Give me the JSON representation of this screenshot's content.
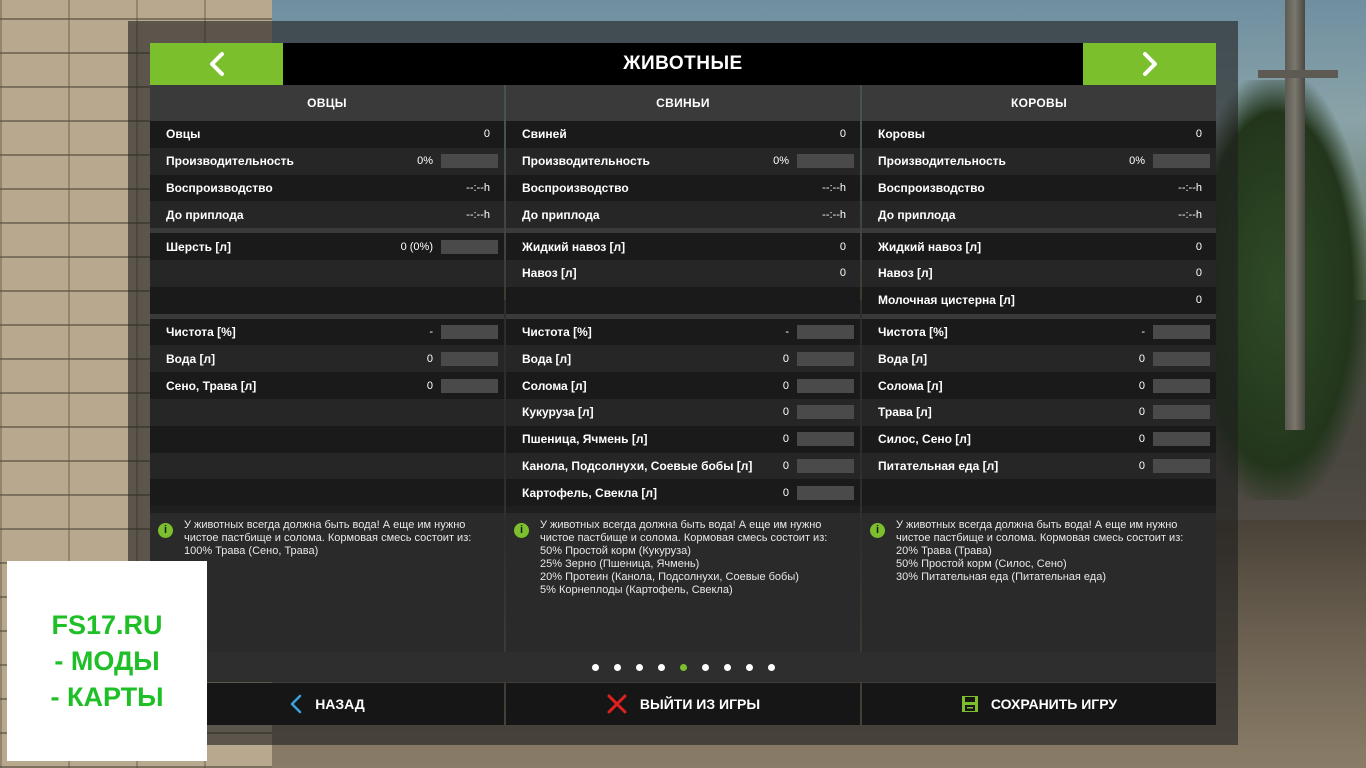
{
  "title": "ЖИВОТНЫЕ",
  "colors": {
    "accent": "#7cbf2d",
    "exit_red": "#e02020",
    "back_blue": "#3aa0e0",
    "save_green": "#7cbf2d",
    "watermark": "#1fbf27"
  },
  "icons": {
    "prev": "chevron-left-icon",
    "next": "chevron-right-icon",
    "info": "info-icon",
    "back": "chevron-left-icon",
    "exit": "close-icon",
    "save": "floppy-disk-icon"
  },
  "columns": [
    {
      "header": "ОВЦЫ",
      "group1": [
        {
          "label": "Овцы",
          "value": "0",
          "bar": false
        },
        {
          "label": "Производительность",
          "value": "0%",
          "bar": true
        },
        {
          "label": "Воспроизводство",
          "value": "--:--h",
          "bar": false
        },
        {
          "label": "До приплода",
          "value": "--:--h",
          "bar": false
        }
      ],
      "group2": [
        {
          "label": "Шерсть [л]",
          "value": "0 (0%)",
          "bar": true
        },
        {
          "label": "",
          "value": "",
          "bar": false
        },
        {
          "label": "",
          "value": "",
          "bar": false
        }
      ],
      "group3": [
        {
          "label": "Чистота [%]",
          "value": "-",
          "bar": true
        },
        {
          "label": "Вода [л]",
          "value": "0",
          "bar": true
        },
        {
          "label": "Сено, Трава [л]",
          "value": "0",
          "bar": true
        },
        {
          "label": "",
          "value": "",
          "bar": false
        },
        {
          "label": "",
          "value": "",
          "bar": false
        },
        {
          "label": "",
          "value": "",
          "bar": false
        },
        {
          "label": "",
          "value": "",
          "bar": false
        }
      ],
      "info": [
        "У животных всегда должна быть вода! А еще им нужно чистое пастбище и солома. Кормовая смесь состоит из:",
        "100% Трава (Сено, Трава)"
      ]
    },
    {
      "header": "СВИНЬИ",
      "group1": [
        {
          "label": "Свиней",
          "value": "0",
          "bar": false
        },
        {
          "label": "Производительность",
          "value": "0%",
          "bar": true
        },
        {
          "label": "Воспроизводство",
          "value": "--:--h",
          "bar": false
        },
        {
          "label": "До приплода",
          "value": "--:--h",
          "bar": false
        }
      ],
      "group2": [
        {
          "label": "Жидкий навоз [л]",
          "value": "0",
          "bar": false
        },
        {
          "label": "Навоз [л]",
          "value": "0",
          "bar": false
        },
        {
          "label": "",
          "value": "",
          "bar": false
        }
      ],
      "group3": [
        {
          "label": "Чистота [%]",
          "value": "-",
          "bar": true
        },
        {
          "label": "Вода [л]",
          "value": "0",
          "bar": true
        },
        {
          "label": "Солома [л]",
          "value": "0",
          "bar": true
        },
        {
          "label": "Кукуруза [л]",
          "value": "0",
          "bar": true
        },
        {
          "label": "Пшеница, Ячмень [л]",
          "value": "0",
          "bar": true
        },
        {
          "label": "Канола, Подсолнухи, Соевые бобы [л]",
          "value": "0",
          "bar": true
        },
        {
          "label": "Картофель, Свекла [л]",
          "value": "0",
          "bar": true
        }
      ],
      "info": [
        "У животных всегда должна быть вода! А еще им нужно чистое пастбище и солома. Кормовая смесь состоит из:",
        "50% Простой корм (Кукуруза)",
        "25% Зерно (Пшеница, Ячмень)",
        "20% Протеин (Канола, Подсолнухи, Соевые бобы)",
        "5% Корнеплоды (Картофель, Свекла)"
      ]
    },
    {
      "header": "КОРОВЫ",
      "group1": [
        {
          "label": "Коровы",
          "value": "0",
          "bar": false
        },
        {
          "label": "Производительность",
          "value": "0%",
          "bar": true
        },
        {
          "label": "Воспроизводство",
          "value": "--:--h",
          "bar": false
        },
        {
          "label": "До приплода",
          "value": "--:--h",
          "bar": false
        }
      ],
      "group2": [
        {
          "label": "Жидкий навоз [л]",
          "value": "0",
          "bar": false
        },
        {
          "label": "Навоз [л]",
          "value": "0",
          "bar": false
        },
        {
          "label": "Молочная цистерна [л]",
          "value": "0",
          "bar": false
        }
      ],
      "group3": [
        {
          "label": "Чистота [%]",
          "value": "-",
          "bar": true
        },
        {
          "label": "Вода [л]",
          "value": "0",
          "bar": true
        },
        {
          "label": "Солома [л]",
          "value": "0",
          "bar": true
        },
        {
          "label": "Трава [л]",
          "value": "0",
          "bar": true
        },
        {
          "label": "Силос, Сено [л]",
          "value": "0",
          "bar": true
        },
        {
          "label": "Питательная еда [л]",
          "value": "0",
          "bar": true
        },
        {
          "label": "",
          "value": "",
          "bar": false
        }
      ],
      "info": [
        "У животных всегда должна быть вода! А еще им нужно чистое пастбище и солома. Кормовая смесь состоит из:",
        "20% Трава (Трава)",
        "50% Простой корм (Силос, Сено)",
        "30% Питательная еда (Питательная еда)"
      ]
    }
  ],
  "pager": {
    "count": 9,
    "active": 4
  },
  "buttons": {
    "back": "НАЗАД",
    "exit": "ВЫЙТИ ИЗ ИГРЫ",
    "save": "СОХРАНИТЬ ИГРУ"
  },
  "watermark": [
    "FS17.RU",
    "- МОДЫ",
    "- КАРТЫ"
  ]
}
